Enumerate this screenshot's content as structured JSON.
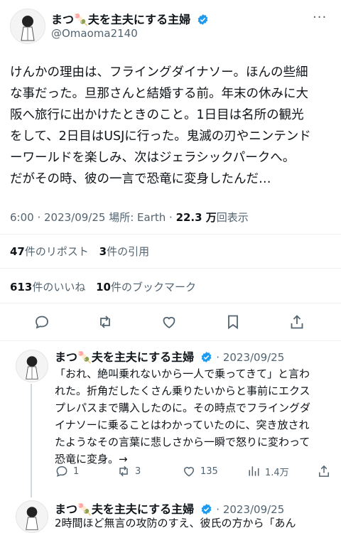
{
  "main_tweet": {
    "author_name": "まつ🍡夫を主夫にする主婦",
    "handle": "@Omaoma2140",
    "more": "···",
    "text_lines": [
      "けんかの理由は、フライングダイナソー。ほんの些細",
      "な事だった。旦那さんと結婚する前。年末の休みに大",
      "阪へ旅行に出かけたときのこと。1日目は名所の観光",
      "をして、2日目はUSJに行った。鬼滅の刃やニンテンド",
      "ーワールドを楽しみ、次はジェラシックパークへ。",
      "だがその時、彼の一言で恐竜に変身したんだ…"
    ],
    "meta": {
      "time_date_place": "6:00 · 2023/09/25 場所: Earth · ",
      "views_count": "22.3 万",
      "views_label": "回表示"
    },
    "retweets": {
      "count": "47",
      "label": "件のリポスト"
    },
    "quotes": {
      "count": "3",
      "label": "件の引用"
    },
    "likes": {
      "count": "613",
      "label": "件のいいね"
    },
    "bookmarks": {
      "count": "10",
      "label": "件のブックマーク"
    }
  },
  "reply_1": {
    "author_name": "まつ🍡夫を主夫にする主婦",
    "date": "· 2023/09/25",
    "text_lines": [
      "「おれ、絶叫乗れないから一人で乗ってきて」と言わ",
      "れた。折角だしたくさん乗りたいからと事前にエクス",
      "プレパスまで購入したのに。その時点でフライングダ",
      "イナソーに乗ることはわかっていたのに、突き放され",
      "たようなその言葉に悲しさから一瞬で怒りに変わって",
      "恐竜に変身。→"
    ],
    "replies": "1",
    "retweets": "3",
    "likes": "135",
    "views": "1.4万"
  },
  "reply_2": {
    "author_name": "まつ🍡夫を主夫にする主婦",
    "date": "· 2023/09/25",
    "text_line": "2時間ほど無言の攻防のすえ、彼氏の方から「あん"
  }
}
